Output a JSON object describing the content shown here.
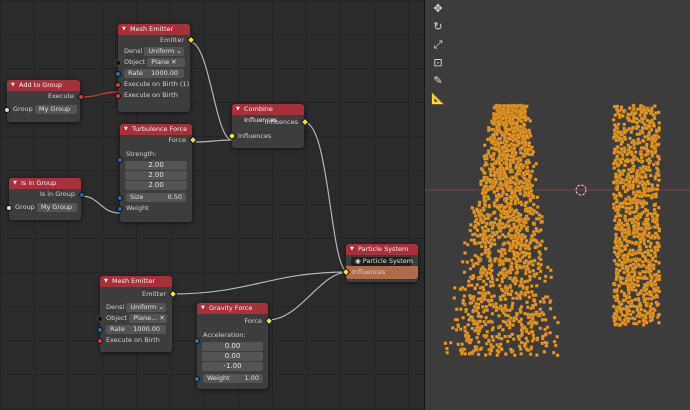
{
  "nodes": {
    "mesh_emitter_1": {
      "title": "Mesh Emitter",
      "output": "Emitter",
      "density_label": "Densi",
      "density_value": "Uniform",
      "object_label": "Object",
      "object_value": "Plane",
      "rate_label": "Rate",
      "rate_value": "1000.00",
      "execute_birth_1": "Execute on Birth (1)",
      "execute_birth": "Execute on Birth"
    },
    "add_to_group": {
      "title": "Add to Group",
      "execute": "Execute",
      "group_label": "Group",
      "group_value": "My Group"
    },
    "turbulence": {
      "title": "Turbulence Force",
      "output": "Force",
      "strength_label": "Strength:",
      "values": [
        "2.00",
        "2.00",
        "2.00"
      ],
      "size_label": "Size",
      "size_value": "0.50",
      "weight_label": "Weight"
    },
    "combine": {
      "title": "Combine Influences",
      "output": "Influences",
      "input": "Influences"
    },
    "is_in_group": {
      "title": "Is in Group",
      "output": "Is in Group",
      "group_label": "Group",
      "group_value": "My Group"
    },
    "particle_system": {
      "title": "Particle System",
      "name": "Particle System",
      "input": "Influences"
    },
    "mesh_emitter_2": {
      "title": "Mesh Emitter",
      "output": "Emitter",
      "density_label": "Densi",
      "density_value": "Uniform",
      "object_label": "Object",
      "object_value": "Plane...",
      "rate_label": "Rate",
      "rate_value": "1000.00",
      "execute_birth": "Execute on Birth"
    },
    "gravity": {
      "title": "Gravity Force",
      "output": "Force",
      "accel_label": "Acceleration:",
      "values": [
        "0.00",
        "0.00",
        "-1.00"
      ],
      "weight_label": "Weight",
      "weight_value": "1.00"
    }
  },
  "viewport_tools": [
    "move-icon",
    "rotate-icon",
    "scale-icon",
    "transform-icon",
    "annotate-icon",
    "measure-icon"
  ],
  "colors": {
    "particle": "#e49a2a",
    "header": "#a8303b",
    "orange_header": "#b06a4c",
    "link": "#b0b0b0"
  }
}
